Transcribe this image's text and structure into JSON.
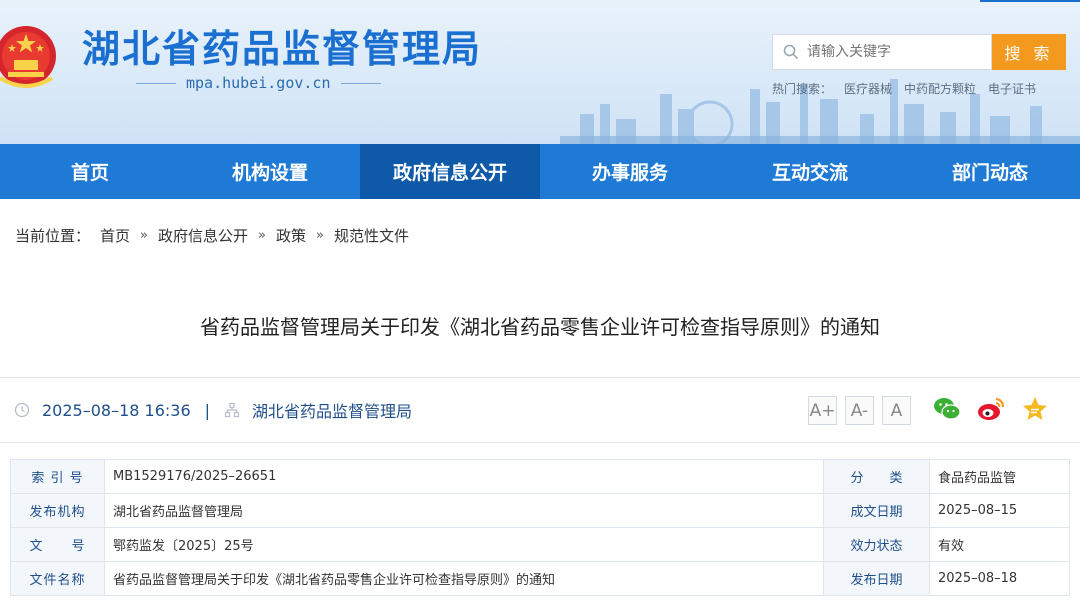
{
  "header": {
    "site_title": "湖北省药品监督管理局",
    "domain": "mpa.hubei.gov.cn",
    "search_placeholder": "请输入关键字",
    "search_button": "搜 索",
    "hot_label": "热门搜索：",
    "hot_items": [
      "医疗器械",
      "中药配方颗粒",
      "电子证书"
    ]
  },
  "nav": {
    "items": [
      "首页",
      "机构设置",
      "政府信息公开",
      "办事服务",
      "互动交流",
      "部门动态"
    ],
    "active": "政府信息公开"
  },
  "breadcrumb": {
    "label": "当前位置：",
    "items": [
      "首页",
      "政府信息公开",
      "政策",
      "规范性文件"
    ],
    "sep": "»"
  },
  "article": {
    "title": "省药品监督管理局关于印发《湖北省药品零售企业许可检查指导原则》的通知",
    "datetime": "2025–08–18 16:36",
    "divider": "|",
    "publisher": "湖北省药品监督管理局",
    "font_sizes": [
      "A+",
      "A-",
      "A"
    ]
  },
  "info_table": {
    "rows": [
      {
        "k1": "索 引 号",
        "v1": "MB1529176/2025–26651",
        "k2": "分　　类",
        "v2": "食品药品监管"
      },
      {
        "k1": "发布机构",
        "v1": "湖北省药品监督管理局",
        "k2": "成文日期",
        "v2": "2025–08–15"
      },
      {
        "k1": "文　　号",
        "v1": "鄂药监发〔2025〕25号",
        "k2": "效力状态",
        "v2": "有效"
      },
      {
        "k1": "文件名称",
        "v1": "省药品监督管理局关于印发《湖北省药品零售企业许可检查指导原则》的通知",
        "k2": "发布日期",
        "v2": "2025–08–18"
      }
    ]
  },
  "colors": {
    "nav": "#1f7ad6",
    "nav_active": "#0f5aa8",
    "title_blue": "#1a6fd1",
    "search_button": "#f39a1e"
  }
}
